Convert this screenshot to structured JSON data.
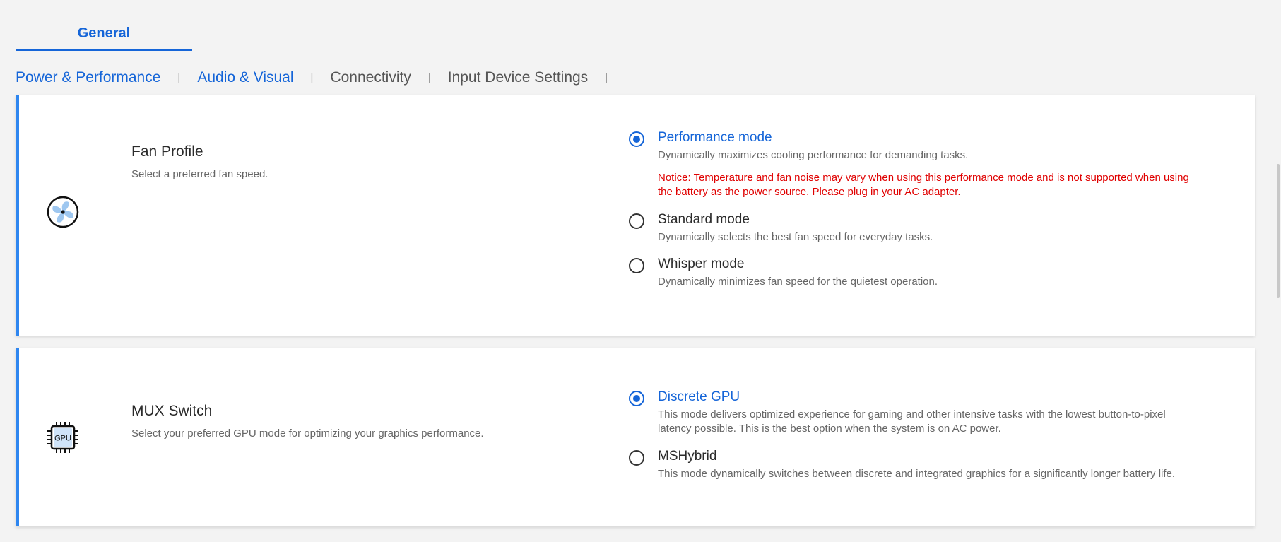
{
  "top_tab": {
    "label": "General"
  },
  "subnav": {
    "items": [
      "Power & Performance",
      "Audio & Visual",
      "Connectivity",
      "Input Device Settings"
    ],
    "separator": "|"
  },
  "colors": {
    "accent": "#1565d8",
    "card_bar": "#2e86f0",
    "notice": "#e00000"
  },
  "fan_profile": {
    "icon": "fan-icon",
    "title": "Fan Profile",
    "description": "Select a preferred fan speed.",
    "options": [
      {
        "label": "Performance mode",
        "selected": true,
        "description": "Dynamically maximizes cooling performance for demanding tasks."
      },
      {
        "label": "Standard mode",
        "selected": false,
        "description": "Dynamically selects the best fan speed for everyday tasks."
      },
      {
        "label": "Whisper mode",
        "selected": false,
        "description": "Dynamically minimizes fan speed for the quietest operation."
      }
    ],
    "notice": "Notice: Temperature and fan noise may vary when using this performance mode and is not supported when using the battery as the power source. Please plug in your AC adapter."
  },
  "mux_switch": {
    "icon": "gpu-chip-icon",
    "icon_text": "GPU",
    "title": "MUX Switch",
    "description": "Select your preferred GPU mode for optimizing your graphics performance.",
    "options": [
      {
        "label": "Discrete GPU",
        "selected": true,
        "description": "This mode delivers optimized experience for gaming and other intensive tasks with the lowest button-to-pixel latency possible. This is the best option when the system is on AC power."
      },
      {
        "label": "MSHybrid",
        "selected": false,
        "description": "This mode dynamically switches between discrete and integrated graphics for a significantly longer battery life."
      }
    ]
  }
}
